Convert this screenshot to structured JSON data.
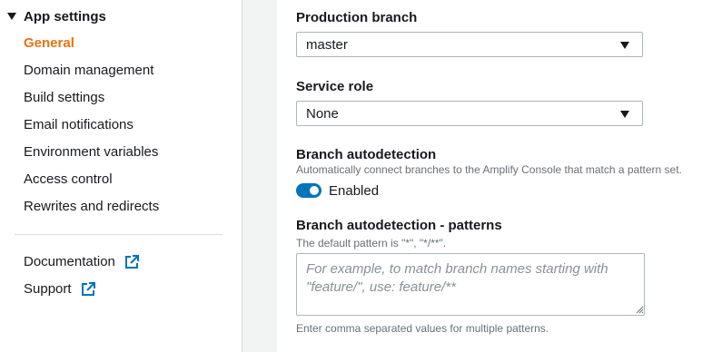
{
  "sidebar": {
    "section_title": "App settings",
    "items": [
      {
        "label": "General",
        "active": true
      },
      {
        "label": "Domain management",
        "active": false
      },
      {
        "label": "Build settings",
        "active": false
      },
      {
        "label": "Email notifications",
        "active": false
      },
      {
        "label": "Environment variables",
        "active": false
      },
      {
        "label": "Access control",
        "active": false
      },
      {
        "label": "Rewrites and redirects",
        "active": false
      }
    ],
    "external_links": [
      {
        "label": "Documentation",
        "icon": "external-link-icon"
      },
      {
        "label": "Support",
        "icon": "external-link-icon"
      }
    ]
  },
  "form": {
    "production_branch": {
      "label": "Production branch",
      "value": "master"
    },
    "service_role": {
      "label": "Service role",
      "value": "None"
    },
    "branch_autodetection": {
      "label": "Branch autodetection",
      "description": "Automatically connect branches to the Amplify Console that match a pattern set.",
      "toggle_label": "Enabled",
      "enabled": true
    },
    "patterns": {
      "label": "Branch autodetection - patterns",
      "description": "The default pattern is \"*\", \"*/**\".",
      "placeholder": "For example, to match branch names starting with \"feature/\", use: feature/**",
      "hint": "Enter comma separated values for multiple patterns."
    }
  },
  "colors": {
    "accent_active": "#ec7211",
    "toggle_on": "#0073bb",
    "link_icon": "#0073bb"
  }
}
